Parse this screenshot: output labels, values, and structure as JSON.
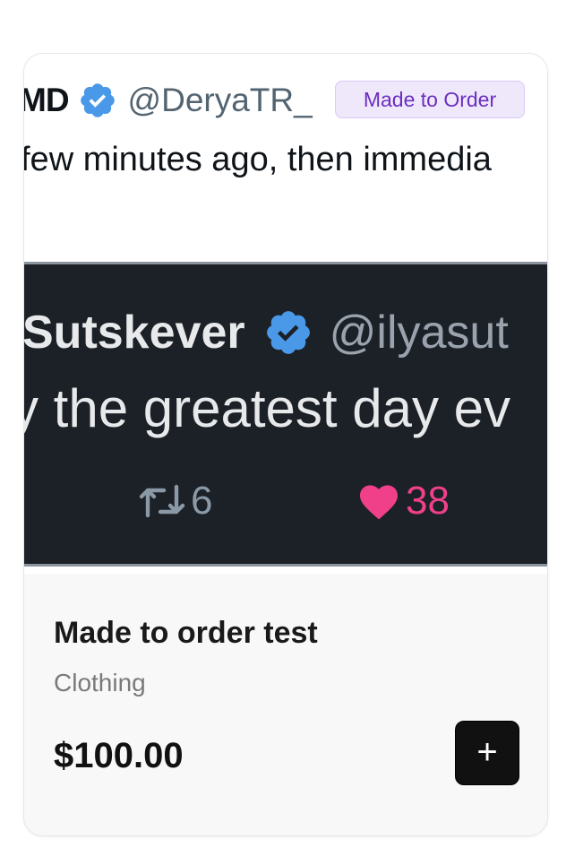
{
  "product": {
    "badge": "Made to Order",
    "title": "Made to order test",
    "category": "Clothing",
    "price": "$100.00",
    "add_label": "+"
  },
  "image": {
    "tweet": {
      "name": "MD",
      "handle": "@DeryaTR_",
      "text": "few minutes ago, then immedia"
    },
    "screenshot": {
      "name": "Sutskever",
      "handle": "@ilyasut",
      "text": "y the greatest day ev",
      "retweets": "6",
      "likes": "38"
    }
  },
  "colors": {
    "verified": "#4a99e9",
    "badge_bg": "#efe8fb",
    "badge_text": "#6b2fc0",
    "like": "#f0408a",
    "button": "#111111"
  },
  "icons": {
    "verified": "verified-badge-icon",
    "retweet": "retweet-icon",
    "like": "heart-icon",
    "add": "plus-icon"
  }
}
